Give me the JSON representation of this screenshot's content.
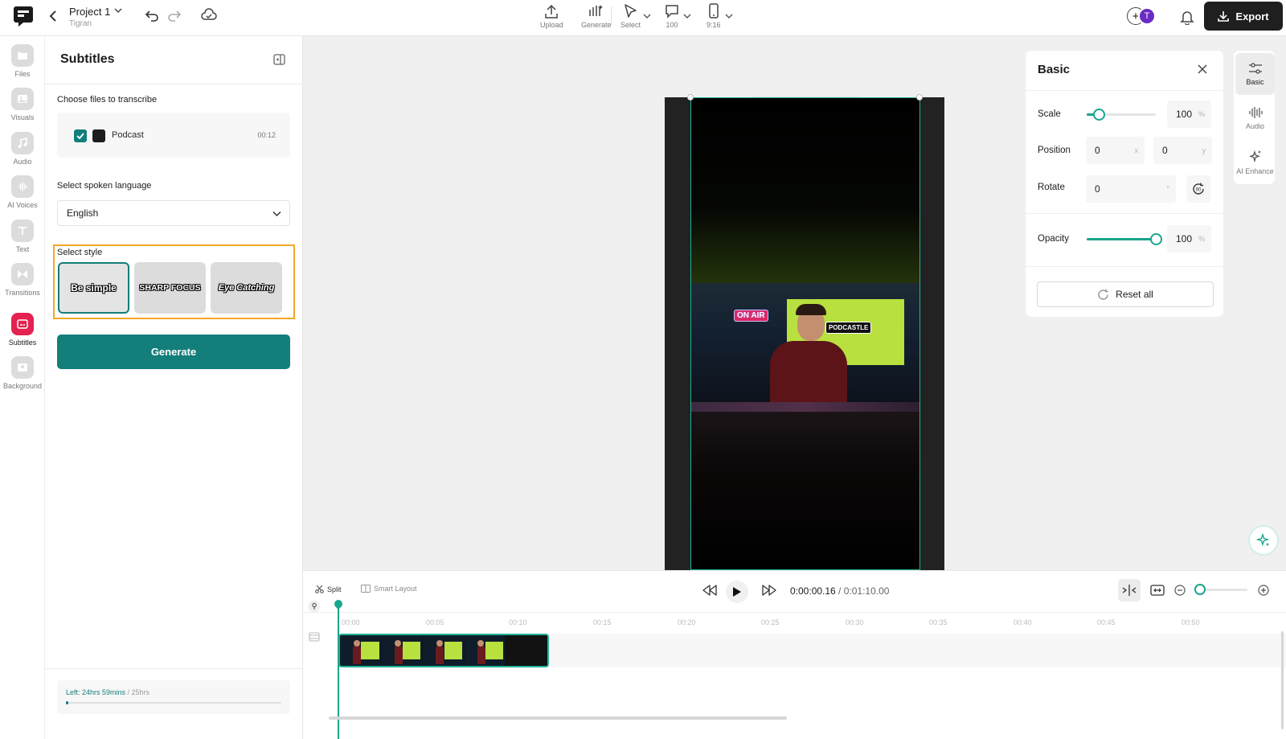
{
  "header": {
    "project_title": "Project 1",
    "project_owner": "Tigran",
    "tools": [
      {
        "label": "Upload",
        "icon": "upload-icon"
      },
      {
        "label": "Generate",
        "icon": "generate-icon"
      },
      {
        "label": "Select",
        "icon": "cursor-icon"
      },
      {
        "label": "100",
        "icon": "comment-icon"
      },
      {
        "label": "9:16",
        "icon": "phone-icon"
      }
    ],
    "avatar_initial": "T",
    "export_label": "Export"
  },
  "rail": {
    "items": [
      {
        "label": "Files",
        "icon": "folder-icon"
      },
      {
        "label": "Visuals",
        "icon": "image-icon"
      },
      {
        "label": "Audio",
        "icon": "music-icon"
      },
      {
        "label": "AI Voices",
        "icon": "ai-voice-icon"
      },
      {
        "label": "Text",
        "icon": "text-icon"
      },
      {
        "label": "Transitions",
        "icon": "transition-icon"
      },
      {
        "label": "Subtitles",
        "icon": "subtitles-icon",
        "active": true
      },
      {
        "label": "Background",
        "icon": "background-icon"
      }
    ]
  },
  "subtitles": {
    "title": "Subtitles",
    "choose_label": "Choose files to transcribe",
    "file": {
      "name": "Podcast",
      "duration": "00:12",
      "checked": true
    },
    "language_label": "Select spoken language",
    "language_value": "English",
    "style_label": "Select style",
    "styles": [
      {
        "label": "Be simple",
        "selected": true
      },
      {
        "label": "SHARP FOCUS",
        "selected": false
      },
      {
        "label": "Eye Catching",
        "selected": false
      }
    ],
    "generate_label": "Generate",
    "quota_left": "Left: 24hrs 59mins",
    "quota_total": " / 25hrs",
    "quota_used_fraction": 0.01
  },
  "preview": {
    "on_air": "ON AIR",
    "brand_tag": "PODCASTLE"
  },
  "basic": {
    "title": "Basic",
    "scale_label": "Scale",
    "scale_value": "100",
    "scale_unit": "%",
    "scale_fraction": 0.18,
    "position_label": "Position",
    "position_x": "0",
    "position_x_unit": "x",
    "position_y": "0",
    "position_y_unit": "y",
    "rotate_label": "Rotate",
    "rotate_value": "0",
    "rotate_unit": "°",
    "opacity_label": "Opacity",
    "opacity_value": "100",
    "opacity_unit": "%",
    "opacity_fraction": 1.0,
    "reset_label": "Reset all"
  },
  "right_tools": [
    {
      "label": "Basic",
      "icon": "sliders-icon",
      "active": true
    },
    {
      "label": "Audio",
      "icon": "waveform-icon"
    },
    {
      "label": "AI Enhance",
      "icon": "sparkles-icon"
    }
  ],
  "timeline": {
    "split_label": "Split",
    "smart_layout_label": "Smart Layout",
    "current_time": "0:00:00.16",
    "total_time": " / 0:01:10.00",
    "ticks": [
      "00:00",
      "00:05",
      "00:10",
      "00:15",
      "00:20",
      "00:25",
      "00:30",
      "00:35",
      "00:40",
      "00:45",
      "00:50"
    ]
  },
  "colors": {
    "accent": "#137e7a",
    "selection": "#1fb395",
    "highlight": "#f5a623",
    "subtitles_active": "#e5224f",
    "export_bg": "#1f1f1f"
  }
}
